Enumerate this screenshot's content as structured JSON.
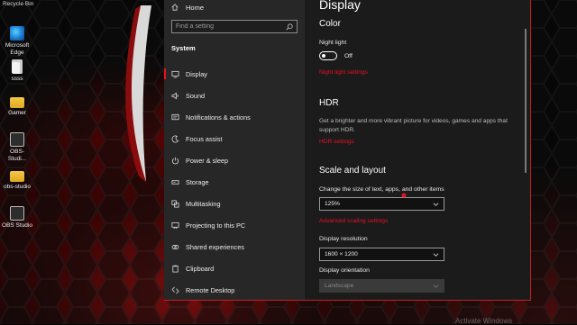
{
  "desktop": {
    "icons": [
      {
        "label": "Recycle Bin"
      },
      {
        "label": "Microsoft Edge"
      },
      {
        "label": "ssss"
      },
      {
        "label": "Gamer"
      },
      {
        "label": "OBS-Studi..."
      },
      {
        "label": "obs-studio"
      },
      {
        "label": "OBS Studio"
      }
    ],
    "watermark": "Activate Windows"
  },
  "settings": {
    "nav": {
      "home": "Home",
      "search_placeholder": "Find a setting",
      "section": "System",
      "items": [
        {
          "label": "Display",
          "icon": "display-icon",
          "active": true
        },
        {
          "label": "Sound",
          "icon": "sound-icon"
        },
        {
          "label": "Notifications & actions",
          "icon": "notifications-icon"
        },
        {
          "label": "Focus assist",
          "icon": "focus-assist-icon"
        },
        {
          "label": "Power & sleep",
          "icon": "power-icon"
        },
        {
          "label": "Storage",
          "icon": "storage-icon"
        },
        {
          "label": "Multitasking",
          "icon": "multitasking-icon"
        },
        {
          "label": "Projecting to this PC",
          "icon": "projecting-icon"
        },
        {
          "label": "Shared experiences",
          "icon": "shared-experiences-icon"
        },
        {
          "label": "Clipboard",
          "icon": "clipboard-icon"
        },
        {
          "label": "Remote Desktop",
          "icon": "remote-desktop-icon"
        }
      ]
    },
    "content": {
      "title": "Display",
      "color": {
        "heading": "Color",
        "night_light_label": "Night light",
        "night_light_state": "Off",
        "night_light_link": "Night light settings"
      },
      "hdr": {
        "heading": "HDR",
        "description": "Get a brighter and more vibrant picture for videos, games and apps that support HDR.",
        "link": "HDR settings"
      },
      "scale": {
        "heading": "Scale and layout",
        "size_label": "Change the size of text, apps, and other items",
        "size_value": "125%",
        "advanced_link": "Advanced scaling settings",
        "resolution_label": "Display resolution",
        "resolution_value": "1600 × 1200",
        "orientation_label": "Display orientation",
        "orientation_value": "Landscape"
      }
    }
  },
  "colors": {
    "accent": "#e81123",
    "window_bg": "#1f1f1f",
    "nav_bg": "#272727"
  }
}
